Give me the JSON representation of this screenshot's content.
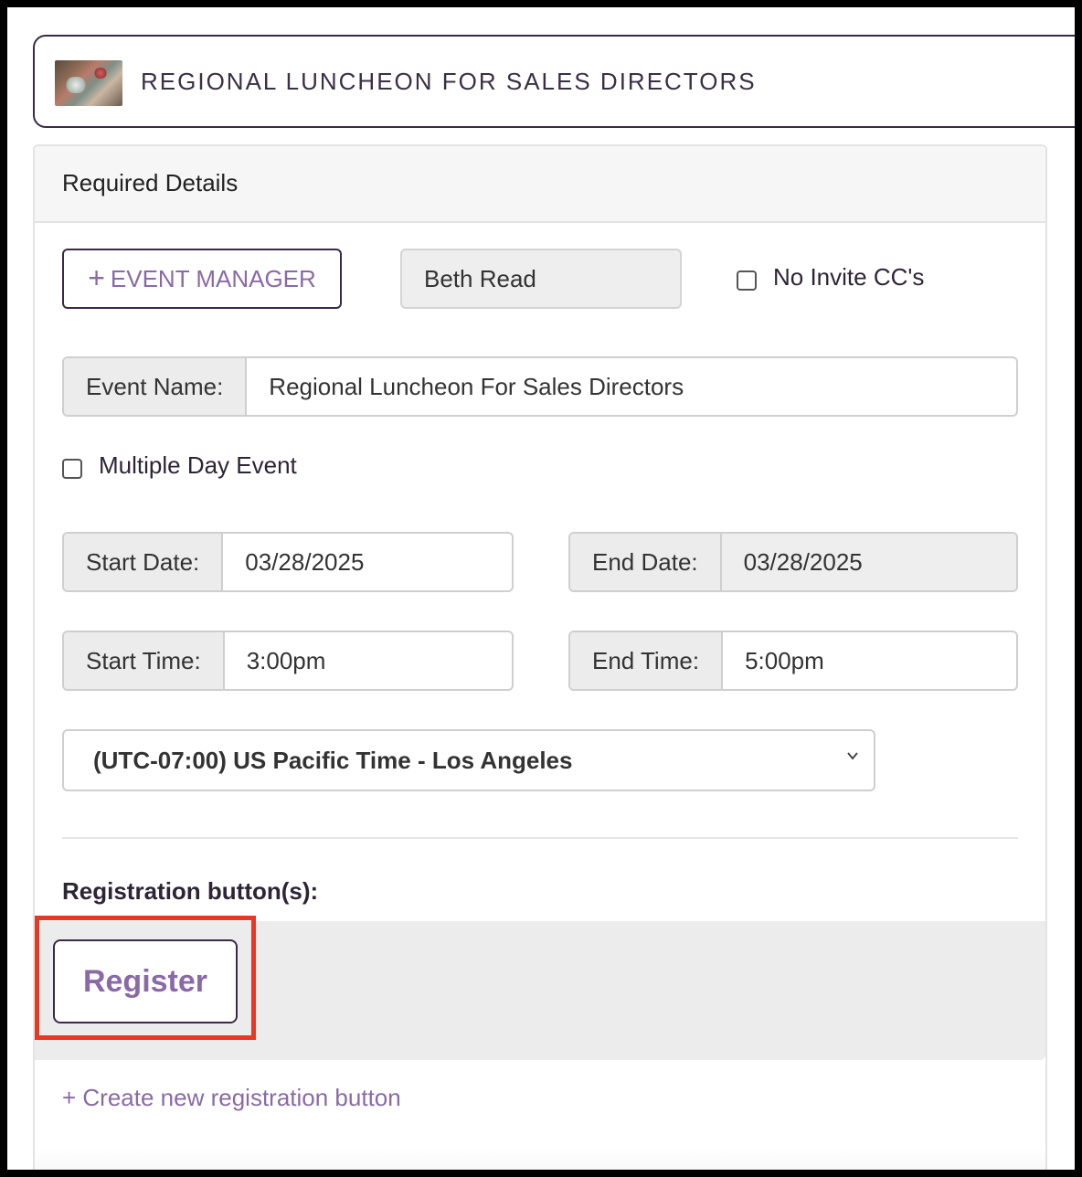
{
  "event": {
    "title": "REGIONAL LUNCHEON FOR SALES DIRECTORS",
    "thumbnail_icon": "event-photo-thumbnail"
  },
  "panel": {
    "title": "Required Details"
  },
  "manager": {
    "button_label": "EVENT MANAGER",
    "button_icon": "plus-icon",
    "name": "Beth Read"
  },
  "no_invite_cc": {
    "label": "No Invite CC's",
    "checked": false
  },
  "event_name": {
    "label": "Event Name:",
    "value": "Regional Luncheon For Sales Directors"
  },
  "multiple_day": {
    "label": "Multiple Day Event",
    "checked": false
  },
  "start_date": {
    "label": "Start Date:",
    "value": "03/28/2025"
  },
  "end_date": {
    "label": "End Date:",
    "value": "03/28/2025"
  },
  "start_time": {
    "label": "Start Time:",
    "value": "3:00pm"
  },
  "end_time": {
    "label": "End Time:",
    "value": "5:00pm"
  },
  "timezone": {
    "selected": "(UTC-07:00) US Pacific Time - Los Angeles"
  },
  "registration": {
    "label": "Registration button(s):",
    "button_label": "Register",
    "create_link": "+ Create new registration button"
  },
  "colors": {
    "accent_purple": "#8a6aa6",
    "border_dark": "#3a2a45",
    "highlight_red": "#e23a24"
  }
}
